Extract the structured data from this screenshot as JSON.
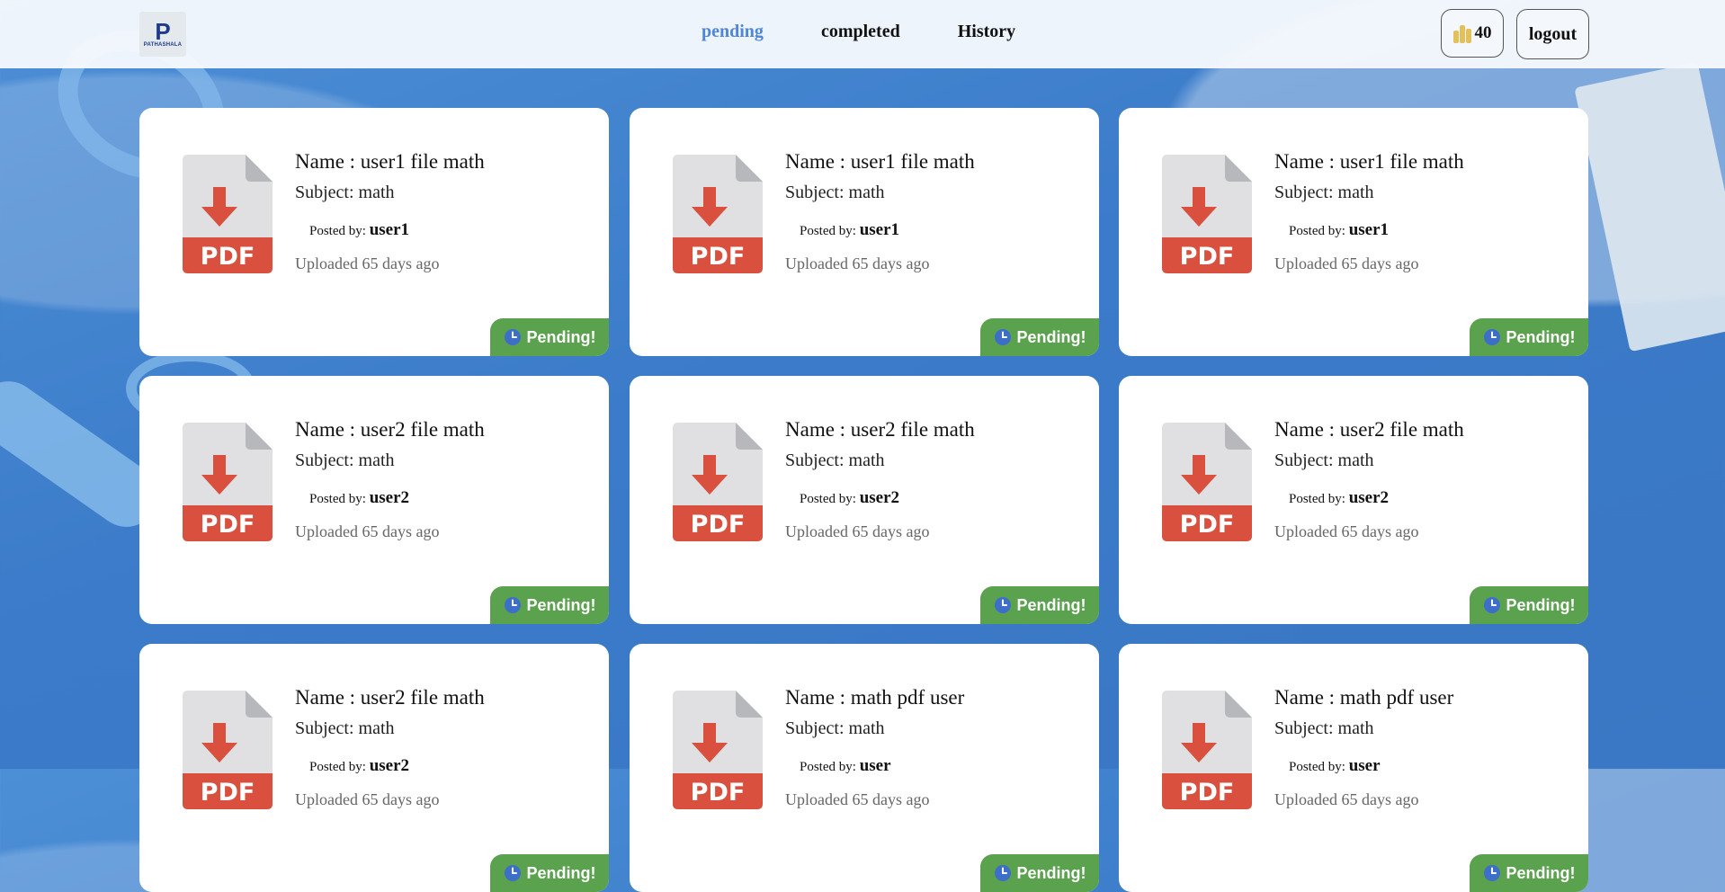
{
  "app": {
    "logo_text": "PATHASHALA",
    "logo_mark": "P"
  },
  "nav": {
    "links": [
      "pending",
      "completed",
      "History"
    ],
    "active": "pending"
  },
  "header": {
    "coins": "40",
    "coin_icon": "coins-icon",
    "logout_label": "logout"
  },
  "colors": {
    "accent": "#4f86d9",
    "badge": "#5aa24d",
    "pdf_red": "#d9503f"
  },
  "cards": [
    {
      "name": "Name : user1 file math",
      "subject": "Subject: math",
      "posted_label": "Posted by:",
      "posted_user": "user1",
      "uploaded": "Uploaded 65 days ago",
      "status": "Pending!"
    },
    {
      "name": "Name : user1 file math",
      "subject": "Subject: math",
      "posted_label": "Posted by:",
      "posted_user": "user1",
      "uploaded": "Uploaded 65 days ago",
      "status": "Pending!"
    },
    {
      "name": "Name : user1 file math",
      "subject": "Subject: math",
      "posted_label": "Posted by:",
      "posted_user": "user1",
      "uploaded": "Uploaded 65 days ago",
      "status": "Pending!"
    },
    {
      "name": "Name : user2 file math",
      "subject": "Subject: math",
      "posted_label": "Posted by:",
      "posted_user": "user2",
      "uploaded": "Uploaded 65 days ago",
      "status": "Pending!"
    },
    {
      "name": "Name : user2 file math",
      "subject": "Subject: math",
      "posted_label": "Posted by:",
      "posted_user": "user2",
      "uploaded": "Uploaded 65 days ago",
      "status": "Pending!"
    },
    {
      "name": "Name : user2 file math",
      "subject": "Subject: math",
      "posted_label": "Posted by:",
      "posted_user": "user2",
      "uploaded": "Uploaded 65 days ago",
      "status": "Pending!"
    },
    {
      "name": "Name : user2 file math",
      "subject": "Subject: math",
      "posted_label": "Posted by:",
      "posted_user": "user2",
      "uploaded": "Uploaded 65 days ago",
      "status": "Pending!"
    },
    {
      "name": "Name : math pdf user",
      "subject": "Subject: math",
      "posted_label": "Posted by:",
      "posted_user": "user",
      "uploaded": "Uploaded 65 days ago",
      "status": "Pending!"
    },
    {
      "name": "Name : math pdf user",
      "subject": "Subject: math",
      "posted_label": "Posted by:",
      "posted_user": "user",
      "uploaded": "Uploaded 65 days ago",
      "status": "Pending!"
    }
  ]
}
